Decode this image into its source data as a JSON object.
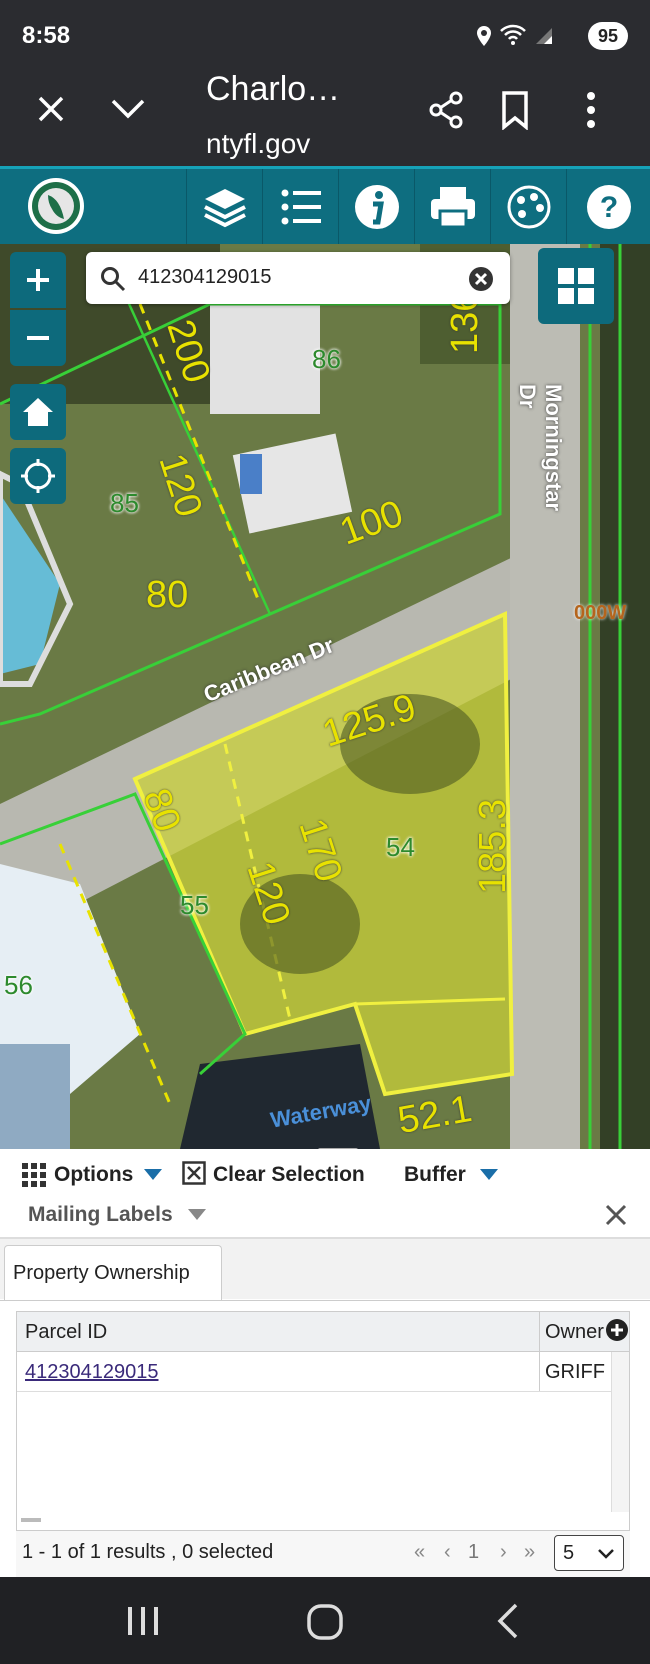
{
  "status": {
    "time": "8:58",
    "battery": "95"
  },
  "browser": {
    "title": "Charlo…",
    "url": "ntyfl.gov"
  },
  "search": {
    "value": "412304129015"
  },
  "map": {
    "streets": {
      "caribbean": "Caribbean Dr",
      "morningstar": "Morningstar Dr",
      "waterway": "Waterway",
      "partial": "000W"
    },
    "dims": [
      "200",
      "120",
      "80",
      "100",
      "136.1",
      "125.9",
      "80",
      "170",
      "120",
      "185.3",
      "52.1"
    ],
    "parcels": [
      "86",
      "85",
      "54",
      "55",
      "56"
    ]
  },
  "panel": {
    "options_label": "Options",
    "clear_label": "Clear Selection",
    "buffer_label": "Buffer",
    "mailing_label": "Mailing Labels",
    "tab_label": "Property Ownership",
    "columns": [
      "Parcel ID",
      "Owner"
    ],
    "rows": [
      {
        "parcel": "412304129015",
        "owner": "GRIFF"
      }
    ],
    "results_text": "1 - 1 of 1 results , 0 selected",
    "page": "1",
    "page_size": "5"
  }
}
